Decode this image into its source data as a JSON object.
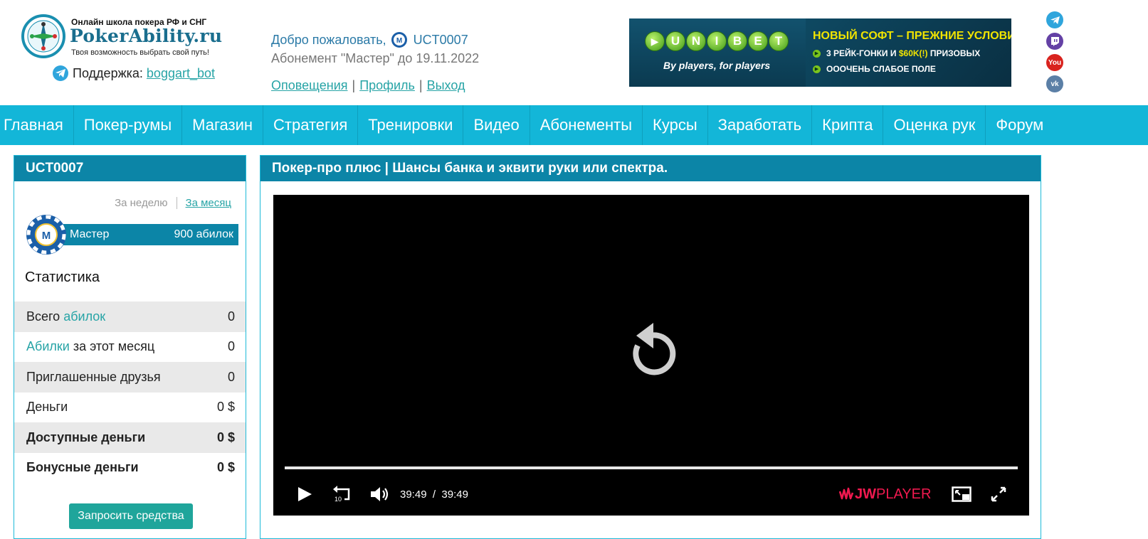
{
  "header": {
    "logo_tagline": "Онлайн школа покера РФ и СНГ",
    "logo_name": "PokerAbility.ru",
    "logo_slogan": "Твоя возможность выбрать свой путь!",
    "support_label": "Поддержка:",
    "support_link": "boggart_bot",
    "welcome_text": "Добро пожаловать,",
    "username": "UCT0007",
    "subscription": "Абонемент \"Мастер\" до 19.11.2022",
    "links": [
      "Оповещения",
      "Профиль",
      "Выход"
    ],
    "link_separator": "|"
  },
  "banner": {
    "brand_letters": [
      "U",
      "N",
      "I",
      "B",
      "E",
      "T"
    ],
    "brand_tagline": "By players, for players",
    "headline": "НОВЫЙ СОФТ – ПРЕЖНИЕ УСЛОВИЯ:",
    "line1_pre": "3 РЕЙК-ГОНКИ И",
    "line1_highlight": "$60K(!)",
    "line1_post": "ПРИЗОВЫХ",
    "line2": "ОООЧЕНЬ СЛАБОЕ ПОЛЕ"
  },
  "social": [
    {
      "name": "telegram-icon",
      "color": "#2fa5dc"
    },
    {
      "name": "twitch-icon",
      "color": "#6441a5"
    },
    {
      "name": "youtube-icon",
      "color": "#d9231e",
      "text": "You"
    },
    {
      "name": "vk-icon",
      "color": "#5b7fa6",
      "text": "vk"
    }
  ],
  "nav": [
    "Главная",
    "Покер-румы",
    "Магазин",
    "Стратегия",
    "Тренировки",
    "Видео",
    "Абонементы",
    "Курсы",
    "Заработать",
    "Крипта",
    "Оценка рук",
    "Форум"
  ],
  "sidebar": {
    "title": "UCT0007",
    "period_week": "За неделю",
    "period_month": "За месяц",
    "rank_chip_letter": "M",
    "rank_name": "Мастер",
    "rank_value": "900 абилок",
    "stats_title": "Статистика",
    "stats": [
      {
        "pre": "Всего ",
        "teal": "абилок",
        "post": "",
        "value": "0"
      },
      {
        "pre": "",
        "teal": "Абилки",
        "post": " за этот месяц",
        "value": "0"
      },
      {
        "pre": "Приглашенные друзья",
        "teal": "",
        "post": "",
        "value": "0"
      },
      {
        "pre": "Деньги",
        "teal": "",
        "post": "",
        "value": "0 $"
      },
      {
        "pre": "Доступные деньги",
        "teal": "",
        "post": "",
        "value": "0 $"
      },
      {
        "pre": "Бонусные деньги",
        "teal": "",
        "post": "",
        "value": "0 $"
      }
    ],
    "request_button": "Запросить средства"
  },
  "main": {
    "title": "Покер-про плюс | Шансы банка и эквити руки или спектра.",
    "player": {
      "elapsed": "39:49",
      "separator": "/",
      "duration": "39:49",
      "progress_fraction": 1.0,
      "rewind_seconds": "10",
      "brand_mark": "JW",
      "brand_text": "PLAYER"
    }
  }
}
